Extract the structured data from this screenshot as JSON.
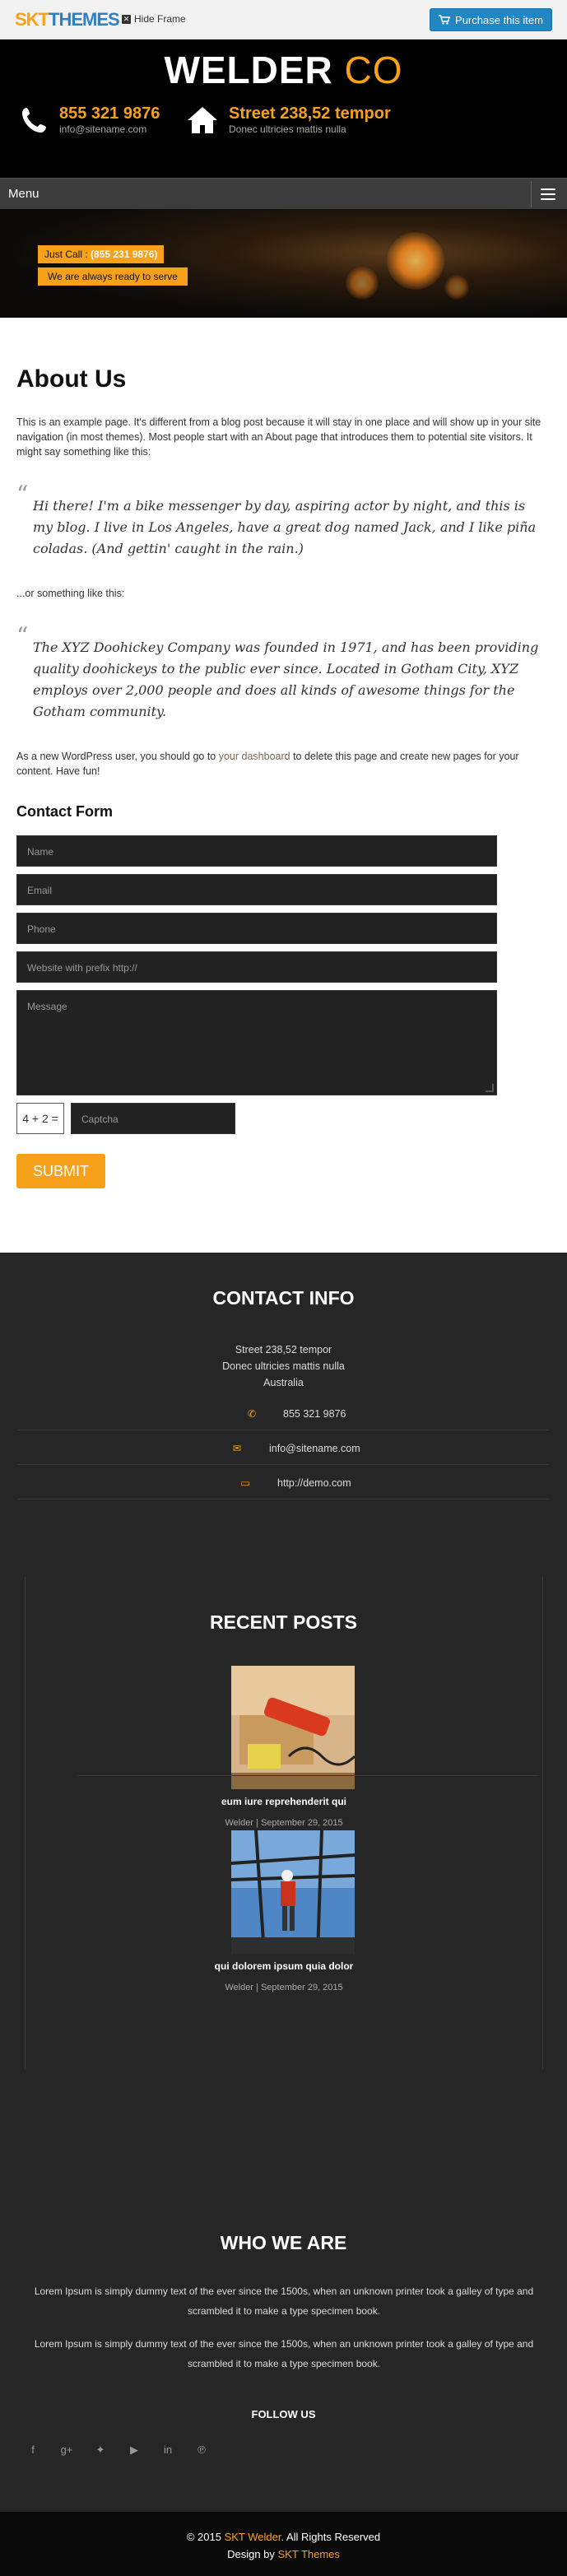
{
  "frame": {
    "logo_skt": "SKT",
    "logo_themes": "THEMES",
    "hide_frame": "Hide Frame",
    "purchase": "Purchase this item"
  },
  "header": {
    "title_main": "WELDER",
    "title_accent": "CO",
    "phone": "855 321 9876",
    "email": "info@sitename.com",
    "street": "Street 238,52 tempor",
    "street_sub": "Donec ultricies mattis nulla"
  },
  "menu": {
    "label": "Menu"
  },
  "banner": {
    "call_label": "Just Call :",
    "call_number": "(855 231 9876)",
    "ready": "We are always ready to serve"
  },
  "page": {
    "title": "About Us",
    "intro": "This is an example page. It's different from a blog post because it will stay in one place and will show up in your site navigation (in most themes). Most people start with an About page that introduces them to potential site visitors. It might say something like this:",
    "quote1": "Hi there! I'm a bike messenger by day, aspiring actor by night, and this is my blog. I live in Los Angeles, have a great dog named Jack, and I like piña coladas. (And gettin' caught in the rain.)",
    "or_text": "...or something like this:",
    "quote2": "The XYZ Doohickey Company was founded in 1971, and has been providing quality doohickeys to the public ever since. Located in Gotham City, XYZ employs over 2,000 people and does all kinds of awesome things for the Gotham community.",
    "after_pre": "As a new WordPress user, you should go to ",
    "after_link": "your dashboard",
    "after_post": " to delete this page and create new pages for your content. Have fun!"
  },
  "form": {
    "title": "Contact Form",
    "name_ph": "Name",
    "email_ph": "Email",
    "phone_ph": "Phone",
    "website_ph": "Website with prefix http://",
    "message_ph": "Message",
    "captcha_question": "4 + 2 =",
    "captcha_ph": "Captcha",
    "submit": "SUBMIT"
  },
  "contact_info": {
    "title": "CONTACT INFO",
    "address_line1": "Street 238,52 tempor",
    "address_line2": "Donec ultricies mattis nulla",
    "address_line3": "Australia",
    "phone": "855 321 9876",
    "email": "info@sitename.com",
    "website": "http://demo.com"
  },
  "recent_posts": {
    "title": "RECENT POSTS",
    "posts": [
      {
        "title": "eum iure reprehenderit qui",
        "author": "Welder",
        "date": "September 29, 2015"
      },
      {
        "title": "qui dolorem ipsum quia dolor",
        "author": "Welder",
        "date": "September 29, 2015"
      }
    ]
  },
  "who_we_are": {
    "title": "WHO WE ARE",
    "text1": "Lorem Ipsum is simply dummy text of the ever since the 1500s, when an unknown printer took a galley of type and scrambled it to make a type specimen book.",
    "text2": "Lorem Ipsum is simply dummy text of the ever since the 1500s, when an unknown printer took a galley of type and scrambled it to make a type specimen book.",
    "follow": "FOLLOW US",
    "socials": [
      "facebook-icon",
      "google-plus-icon",
      "twitter-icon",
      "youtube-icon",
      "linkedin-icon",
      "pinterest-icon"
    ]
  },
  "footer": {
    "copy_pre": "© 2015 ",
    "copy_brand": "SKT Welder",
    "copy_post": ". All Rights Reserved",
    "design_pre": "Design by ",
    "design_brand": "SKT Themes"
  },
  "colors": {
    "accent": "#f7a11a",
    "dark": "#262626",
    "header_bg": "#000000",
    "purchase_blue": "#2186c4"
  }
}
